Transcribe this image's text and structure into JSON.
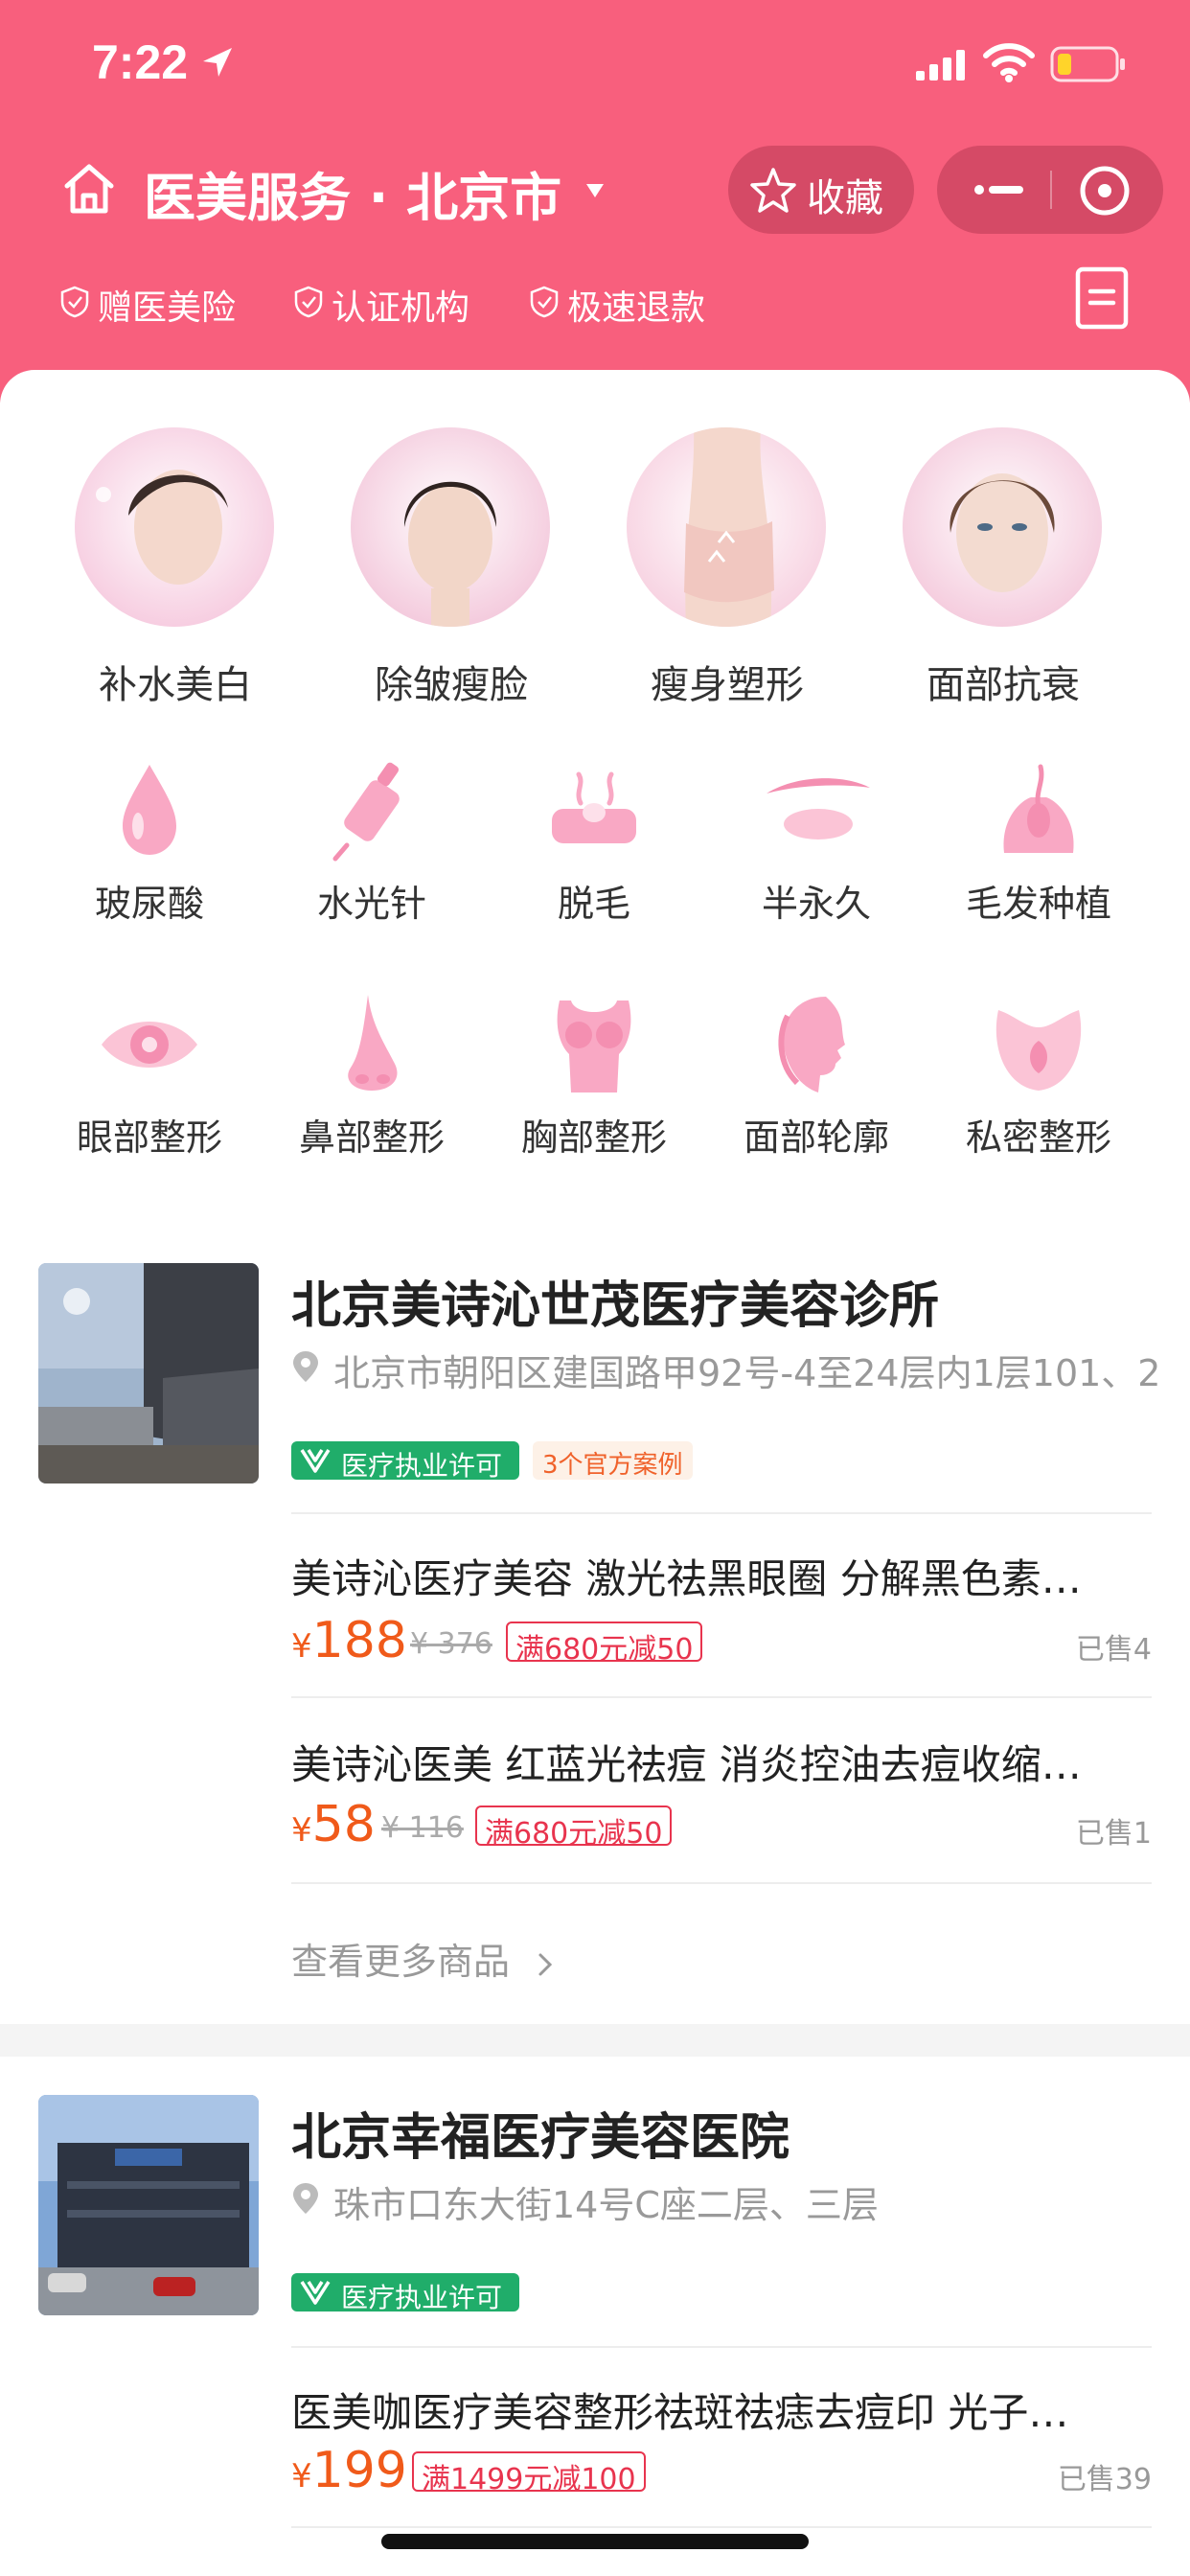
{
  "status_bar": {
    "time": "7:22"
  },
  "header": {
    "title": "医美服务 · 北京市",
    "favorite_label": "收藏",
    "tags": [
      "赠医美险",
      "认证机构",
      "极速退款"
    ]
  },
  "categories_large": [
    {
      "label": "补水美白"
    },
    {
      "label": "除皱瘦脸"
    },
    {
      "label": "瘦身塑形"
    },
    {
      "label": "面部抗衰"
    }
  ],
  "categories_small": [
    {
      "label": "玻尿酸",
      "icon": "droplet-icon"
    },
    {
      "label": "水光针",
      "icon": "syringe-icon"
    },
    {
      "label": "脱毛",
      "icon": "hair-removal-icon"
    },
    {
      "label": "半永久",
      "icon": "eyebrow-icon"
    },
    {
      "label": "毛发种植",
      "icon": "hair-follicle-icon"
    },
    {
      "label": "眼部整形",
      "icon": "eye-icon"
    },
    {
      "label": "鼻部整形",
      "icon": "nose-icon"
    },
    {
      "label": "胸部整形",
      "icon": "chest-icon"
    },
    {
      "label": "面部轮廓",
      "icon": "face-profile-icon"
    },
    {
      "label": "私密整形",
      "icon": "private-icon"
    }
  ],
  "shops": [
    {
      "name": "北京美诗沁世茂医疗美容诊所",
      "address": "北京市朝阳区建国路甲92号-4至24层内1层101、2",
      "license": "医疗执业许可",
      "cases": "3个官方案例",
      "products": [
        {
          "title": "美诗沁医疗美容 激光祛黑眼圈 分解黑色素…",
          "yen": "¥",
          "price": "188",
          "original": "¥ 376",
          "promo": "满680元减50",
          "sold": "已售4"
        },
        {
          "title": "美诗沁医美 红蓝光祛痘 消炎控油去痘收缩…",
          "yen": "¥",
          "price": "58",
          "original": "¥ 116",
          "promo": "满680元减50",
          "sold": "已售1"
        }
      ],
      "more": "查看更多商品"
    },
    {
      "name": "北京幸福医疗美容医院",
      "address": "珠市口东大街14号C座二层、三层",
      "license": "医疗执业许可",
      "products": [
        {
          "title": "医美咖医疗美容整形祛斑祛痣去痘印 光子…",
          "yen": "¥",
          "price": "199",
          "promo": "满1499元减100",
          "sold": "已售39"
        }
      ]
    }
  ],
  "colors": {
    "header": "#f85f7d",
    "price": "#f05a1a",
    "promo": "#e8344e",
    "license": "#20ad6a"
  }
}
